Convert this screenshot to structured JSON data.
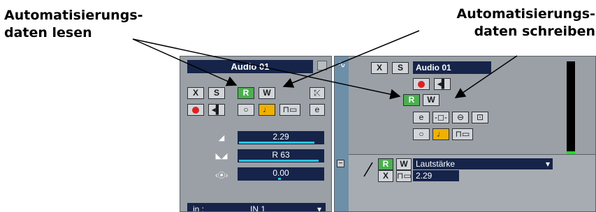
{
  "callouts": {
    "read_line1": "Automatisierungs-",
    "read_line2": "daten lesen",
    "write_line1": "Automatisierungs-",
    "write_line2": "daten schreiben"
  },
  "inspector": {
    "track_name": "Audio 01",
    "buttons": {
      "mute": "X",
      "solo": "S",
      "read": "R",
      "write": "W",
      "edit": "e"
    },
    "params": [
      {
        "icon": "volume-icon",
        "value": "2.29",
        "level": 0.9
      },
      {
        "icon": "pan-icon",
        "value": "R 63",
        "level": 0.95
      },
      {
        "icon": "delay-icon",
        "value": "0.00",
        "level": 0.5
      }
    ],
    "input_label": "in :",
    "input_value": "IN 1"
  },
  "tracklist": {
    "track_name": "Audio 01",
    "buttons": {
      "mute": "X",
      "solo": "S",
      "read": "R",
      "write": "W",
      "edit": "e"
    },
    "meter_level": 0.08,
    "lane_param": "Lautstärke",
    "lane_value": "2.29",
    "lane_read": "R",
    "lane_write": "W",
    "lane_mute": "X"
  },
  "colors": {
    "panel": "#9aa0a6",
    "field": "#16244a",
    "green": "#4caf50",
    "record": "#e02020",
    "meter": "#1ee01e"
  }
}
